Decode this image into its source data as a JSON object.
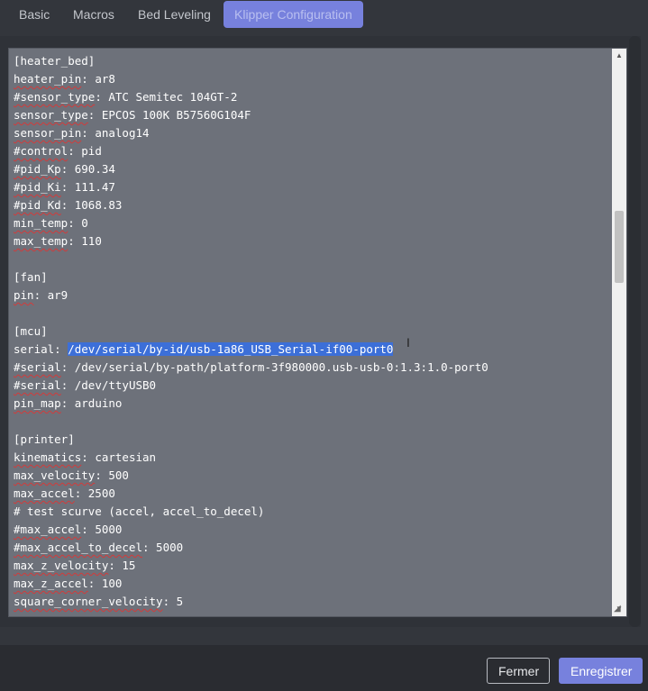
{
  "tabs": [
    {
      "label": "Basic",
      "active": false
    },
    {
      "label": "Macros",
      "active": false
    },
    {
      "label": "Bed Leveling",
      "active": false
    },
    {
      "label": "Klipper Configuration",
      "active": true
    }
  ],
  "editor": {
    "lines": [
      "[heater_bed]",
      "heater_pin: ar8",
      "#sensor_type: ATC Semitec 104GT-2",
      "sensor_type: EPCOS 100K B57560G104F",
      "sensor_pin: analog14",
      "#control: pid",
      "#pid_Kp: 690.34",
      "#pid_Ki: 111.47",
      "#pid_Kd: 1068.83",
      "min_temp: 0",
      "max_temp: 110",
      "",
      "[fan]",
      "pin: ar9",
      "",
      "[mcu]",
      "serial: /dev/serial/by-id/usb-1a86_USB_Serial-if00-port0",
      "#serial: /dev/serial/by-path/platform-3f980000.usb-usb-0:1.3:1.0-port0",
      "#serial: /dev/ttyUSB0",
      "pin_map: arduino",
      "",
      "[printer]",
      "kinematics: cartesian",
      "max_velocity: 500",
      "max_accel: 2500",
      "# test scurve (accel, accel_to_decel)",
      "#max_accel: 5000",
      "#max_accel_to_decel: 5000",
      "max_z_velocity: 15",
      "max_z_accel: 100",
      "square_corner_velocity: 5"
    ],
    "selected_text": "/dev/serial/by-id/usb-1a86_USB_Serial-if00-port0"
  },
  "footer": {
    "close_label": "Fermer",
    "save_label": "Enregistrer"
  },
  "colors": {
    "accent": "#7781dd",
    "editor_bg": "#6d717a",
    "page_bg": "#33363c",
    "selection": "#3c6fd8"
  }
}
